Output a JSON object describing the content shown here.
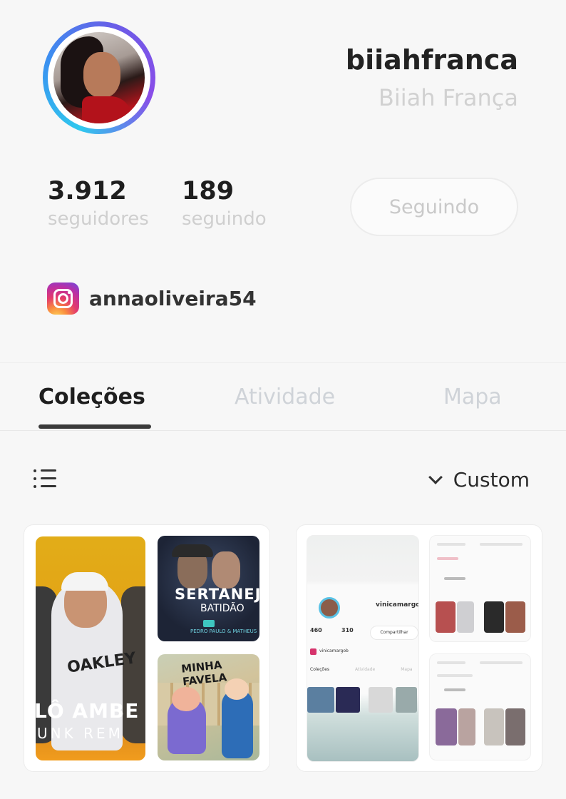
{
  "profile": {
    "username": "biiahfranca",
    "full_name": "Biiah França",
    "followers_count": "3.912",
    "followers_label": "seguidores",
    "following_count": "189",
    "following_label": "seguindo",
    "follow_button_label": "Seguindo",
    "instagram_handle": "annaoliveira54"
  },
  "tabs": [
    {
      "label": "Coleções",
      "active": true
    },
    {
      "label": "Atividade",
      "active": false
    },
    {
      "label": "Mapa",
      "active": false
    }
  ],
  "toolbar": {
    "sort_label": "Custom"
  },
  "collections": [
    {
      "thumbs": {
        "funk_text": "LÔ AMBE",
        "funk_sub": "UNK REM",
        "funk_shirt": "OAKLEY",
        "sertanejo_title": "SERTANEJO",
        "sertanejo_sub": "BATIDÃO",
        "sertanejo_artist": "PEDRO PAULO & MATHEUS",
        "favela_title": "MINHA FAVELA"
      }
    },
    {
      "mini_profile": {
        "username": "vinicamargob",
        "followers": "460",
        "following": "310",
        "button": "Compartilhar",
        "instagram": "vinicamargob",
        "tab1": "Coleções",
        "tab2": "Atividade",
        "tab3": "Mapa"
      }
    }
  ],
  "colors": {
    "accent_ring_start": "#2fc8ee",
    "accent_ring_end": "#8a4de8",
    "active_tab": "#1e1e1e",
    "inactive_tab": "#cfd3d8"
  }
}
